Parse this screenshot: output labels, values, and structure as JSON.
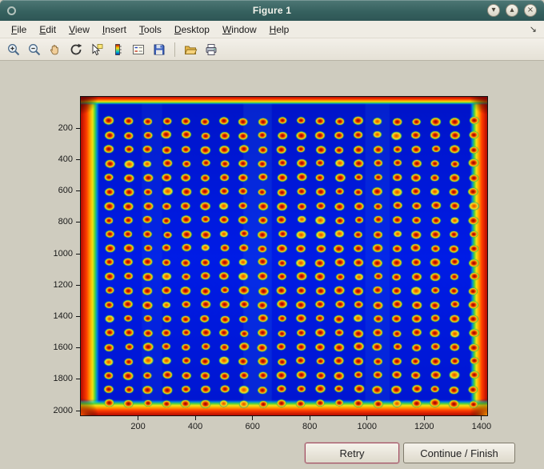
{
  "window": {
    "title": "Figure 1",
    "controls": {
      "minimize": "▾",
      "maximize": "▴",
      "close": "×"
    }
  },
  "menubar": {
    "items": [
      "File",
      "Edit",
      "View",
      "Insert",
      "Tools",
      "Desktop",
      "Window",
      "Help"
    ],
    "dock_glyph": "↘"
  },
  "toolbar": {
    "tools": [
      "Zoom In",
      "Zoom Out",
      "Pan",
      "Rotate 3D",
      "Data Cursor",
      "Insert Colorbar",
      "Insert Legend",
      "Save Figure",
      "Open File",
      "Print Figure"
    ]
  },
  "chart_data": {
    "type": "heatmap",
    "title": "",
    "xlabel": "",
    "ylabel": "",
    "colormap": "jet",
    "description": "Thermal/intensity image of a micro-well plate: blue (cold) field with a regular grid of hot red/yellow spots and hot red edges along the plate borders",
    "xlim": [
      0,
      1420
    ],
    "ylim": [
      0,
      2030
    ],
    "x_ticks": [
      200,
      400,
      600,
      800,
      1000,
      1200,
      1400
    ],
    "y_ticks": [
      200,
      400,
      600,
      800,
      1000,
      1200,
      1400,
      1600,
      1800,
      2000
    ],
    "spots": {
      "rows": 21,
      "cols": 20,
      "x0": 100,
      "dx": 67,
      "y0": 155,
      "dy": 90
    },
    "grid": false,
    "legend": false
  },
  "buttons": {
    "retry": "Retry",
    "continue_finish": "Continue / Finish"
  }
}
